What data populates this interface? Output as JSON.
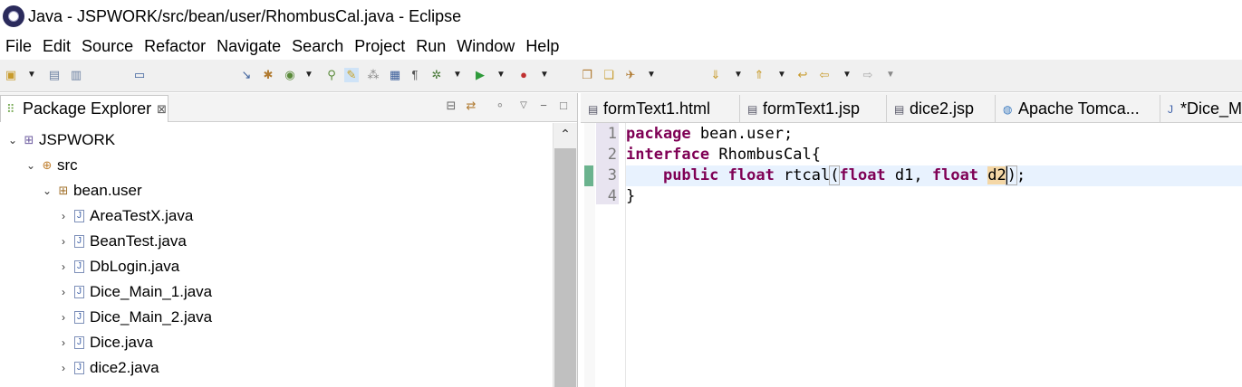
{
  "window": {
    "title": "Java - JSPWORK/src/bean/user/RhombusCal.java - Eclipse"
  },
  "menu": [
    "File",
    "Edit",
    "Source",
    "Refactor",
    "Navigate",
    "Search",
    "Project",
    "Run",
    "Window",
    "Help"
  ],
  "package_explorer": {
    "tab_label": "Package Explorer",
    "close_glyph": "⊠",
    "tree": [
      {
        "label": "JSPWORK",
        "type": "project",
        "expanded": true
      },
      {
        "label": "src",
        "type": "source-folder",
        "expanded": true
      },
      {
        "label": "bean.user",
        "type": "package",
        "expanded": true
      },
      {
        "label": "AreaTestX.java",
        "type": "java-file",
        "expanded": false
      },
      {
        "label": "BeanTest.java",
        "type": "java-file",
        "expanded": false
      },
      {
        "label": "DbLogin.java",
        "type": "java-file",
        "expanded": false
      },
      {
        "label": "Dice_Main_1.java",
        "type": "java-file",
        "expanded": false
      },
      {
        "label": "Dice_Main_2.java",
        "type": "java-file",
        "expanded": false
      },
      {
        "label": "Dice.java",
        "type": "java-file",
        "expanded": false
      },
      {
        "label": "dice2.java",
        "type": "java-file",
        "expanded": false
      }
    ]
  },
  "editor": {
    "tabs": [
      {
        "label": "formText1.html",
        "icon": "html-file-icon"
      },
      {
        "label": "formText1.jsp",
        "icon": "jsp-file-icon"
      },
      {
        "label": "dice2.jsp",
        "icon": "jsp-file-icon"
      },
      {
        "label": "Apache Tomca...",
        "icon": "globe-icon"
      },
      {
        "label": "*Dice_M",
        "icon": "java-file-icon"
      }
    ],
    "line_numbers": [
      "1",
      "2",
      "3",
      "4"
    ],
    "code": {
      "l1_kw": "package",
      "l1_rest": " bean.user;",
      "l2_kw": "interface",
      "l2_rest": " RhombusCal{",
      "l3_indent": "    ",
      "l3_kw1": "public",
      "l3_sp1": " ",
      "l3_kw2": "float",
      "l3_name": " rtcal",
      "l3_open": "(",
      "l3_kw3": "float",
      "l3_p1": " d1, ",
      "l3_kw4": "float",
      "l3_sp2": " ",
      "l3_p2": "d2",
      "l3_close": ")",
      "l3_end": ";",
      "l4": "}"
    }
  },
  "colors": {
    "keyword": "#7f0055",
    "current_line": "#e8f2fe",
    "change_marker": "#6bb38e",
    "highlight": "#f4d7a6"
  }
}
